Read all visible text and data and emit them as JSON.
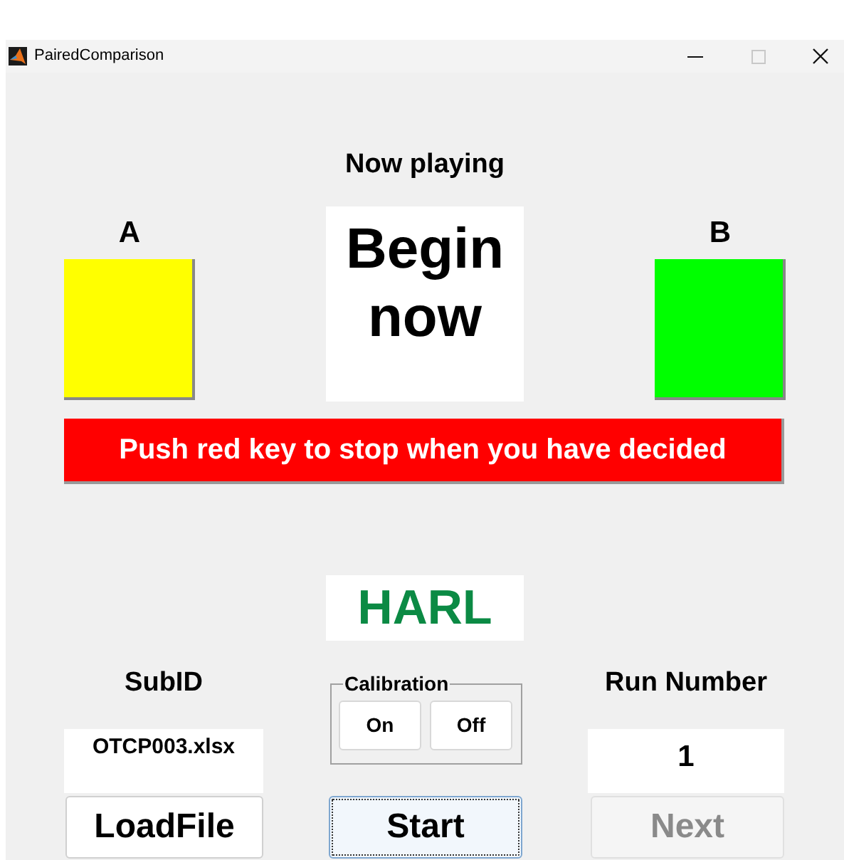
{
  "window": {
    "title": "PairedComparison"
  },
  "now_playing": {
    "label": "Now playing",
    "message": "Begin now"
  },
  "choices": [
    {
      "label": "A",
      "color": "#ffff00"
    },
    {
      "label": "B",
      "color": "#00ff00"
    }
  ],
  "stop_banner": "Push red key to stop when you have decided",
  "condition": "HARL",
  "subject": {
    "label": "SubID",
    "value": "OTCP003.xlsx"
  },
  "calibration": {
    "title": "Calibration",
    "buttons": [
      "On",
      "Off"
    ]
  },
  "run": {
    "label": "Run Number",
    "value": "1"
  },
  "buttons": [
    {
      "label": "LoadFile",
      "disabled": false,
      "focused": false
    },
    {
      "label": "Start",
      "disabled": false,
      "focused": true
    },
    {
      "label": "Next",
      "disabled": true,
      "focused": false
    }
  ]
}
